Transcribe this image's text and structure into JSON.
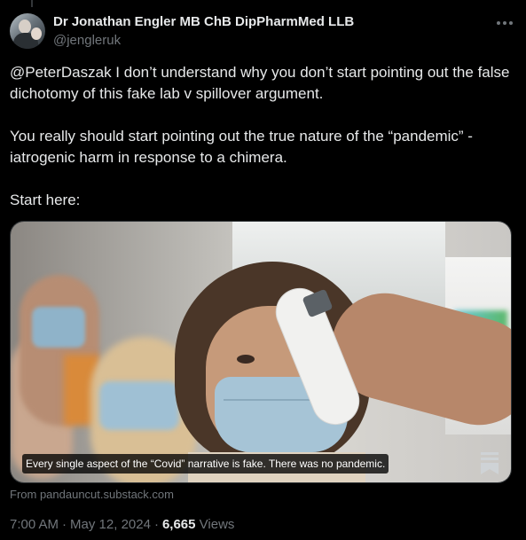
{
  "author": {
    "display_name": "Dr Jonathan Engler MB ChB DipPharmMed LLB",
    "handle": "@jengleruk"
  },
  "tweet": {
    "paragraphs": [
      "@PeterDaszak I don’t understand why you don’t start pointing out the false dichotomy of this fake lab v spillover argument.",
      "You really should start pointing out the true nature of the “pandemic” - iatrogenic harm in response to a chimera.",
      "Start here:"
    ]
  },
  "card": {
    "caption": "Every single aspect of the “Covid” narrative is fake. There was no pandemic.",
    "source": "From pandauncut.substack.com"
  },
  "meta": {
    "time": "7:00 AM",
    "date": "May 12, 2024",
    "separator": "·",
    "views_count": "6,665",
    "views_label": "Views"
  },
  "icons": {
    "more": "more-horizontal-icon",
    "bookmark": "bookmark-icon"
  },
  "colors": {
    "background": "#000000",
    "text": "#e7e9ea",
    "secondary": "#71767b"
  }
}
